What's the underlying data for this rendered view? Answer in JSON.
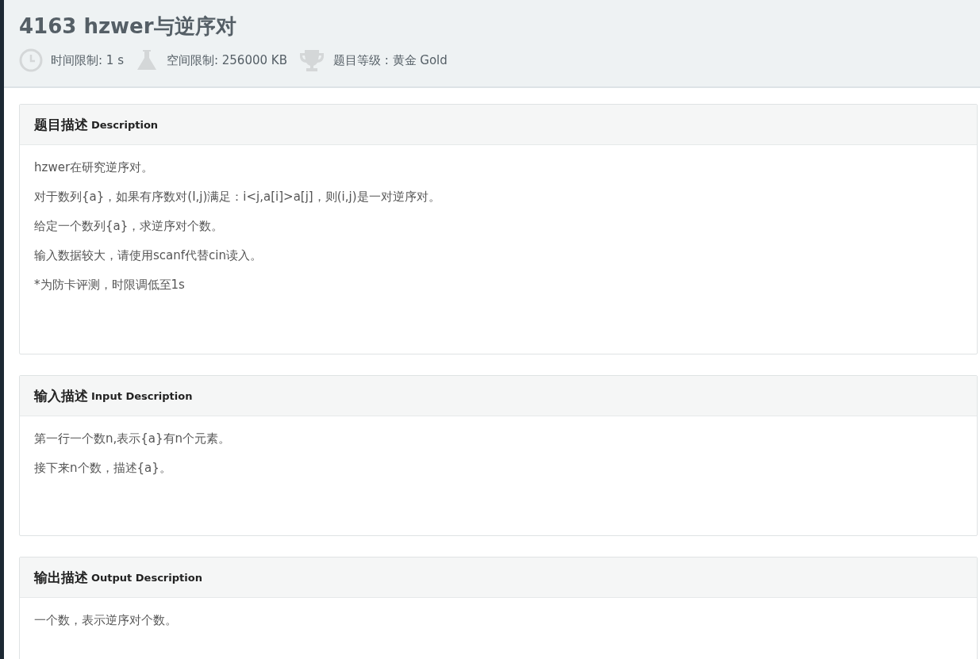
{
  "problem": {
    "title": "4163 hzwer与逆序对",
    "meta": [
      {
        "kind": "clock",
        "text": "时间限制: 1 s"
      },
      {
        "kind": "flask",
        "text": "空间限制: 256000 KB"
      },
      {
        "kind": "trophy",
        "text": "题目等级 : 黄金 Gold"
      }
    ]
  },
  "sections": [
    {
      "title": "题目描述",
      "subtitle": "Description",
      "lines": [
        "hzwer在研究逆序对。",
        "对于数列{a}，如果有序数对(I,j)满足：i<j,a[i]>a[j]，则(i,j)是一对逆序对。",
        "给定一个数列{a}，求逆序对个数。",
        "输入数据较大，请使用scanf代替cin读入。",
        "*为防卡评测，时限调低至1s"
      ]
    },
    {
      "title": "输入描述",
      "subtitle": "Input Description",
      "lines": [
        "第一行一个数n,表示{a}有n个元素。",
        "接下来n个数，描述{a}。"
      ]
    },
    {
      "title": "输出描述",
      "subtitle": "Output Description",
      "lines": [
        "一个数，表示逆序对个数。"
      ]
    }
  ]
}
